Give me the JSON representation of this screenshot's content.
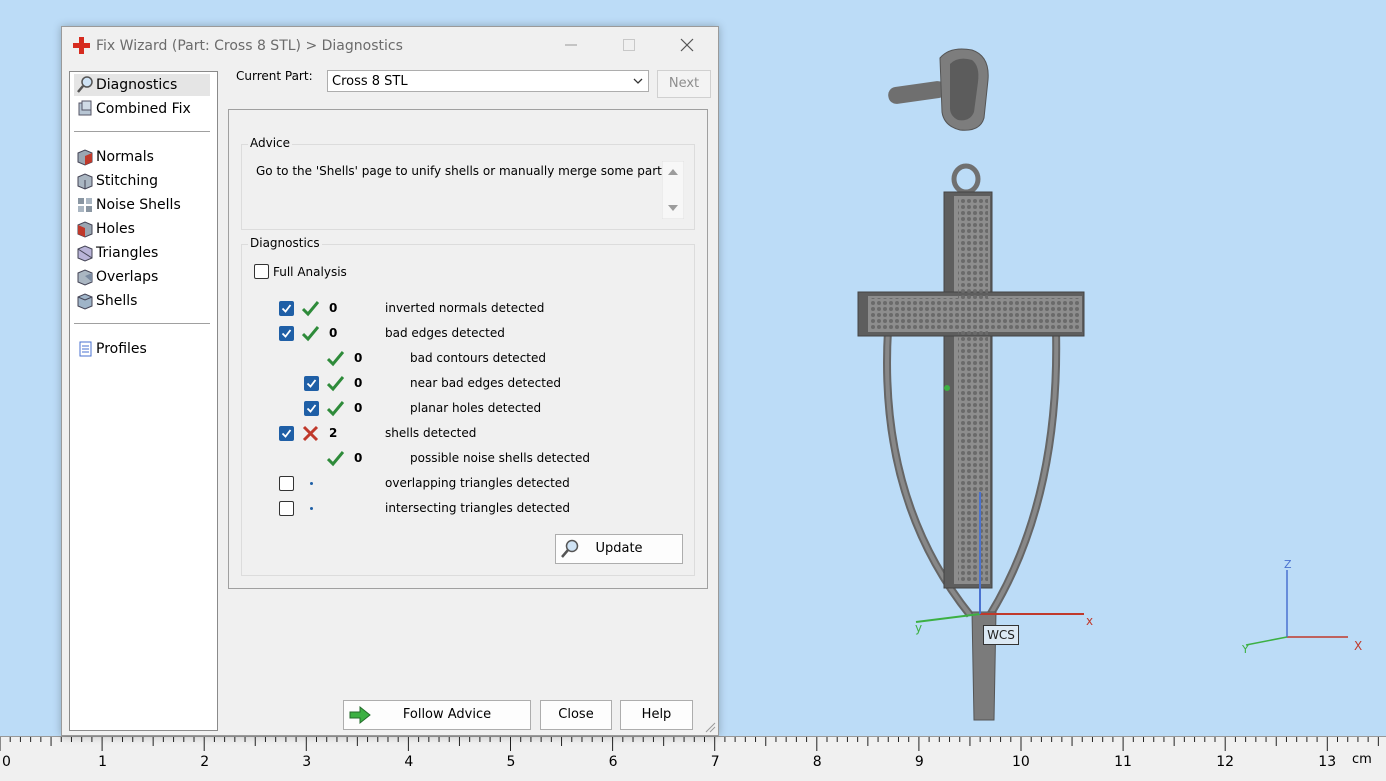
{
  "window": {
    "title": "Fix Wizard (Part: Cross 8 STL) > Diagnostics"
  },
  "nav": {
    "items": [
      {
        "label": "Diagnostics",
        "icon": "magnifier-icon"
      },
      {
        "label": "Combined Fix",
        "icon": "combined-fix-icon"
      },
      {
        "label": "Normals",
        "icon": "normals-cube-icon"
      },
      {
        "label": "Stitching",
        "icon": "stitching-cube-icon"
      },
      {
        "label": "Noise Shells",
        "icon": "noise-shells-cube-icon"
      },
      {
        "label": "Holes",
        "icon": "holes-cube-icon"
      },
      {
        "label": "Triangles",
        "icon": "triangles-cube-icon"
      },
      {
        "label": "Overlaps",
        "icon": "overlaps-cube-icon"
      },
      {
        "label": "Shells",
        "icon": "shells-cube-icon"
      },
      {
        "label": "Profiles",
        "icon": "document-icon"
      }
    ],
    "selected": "Diagnostics"
  },
  "part": {
    "label": "Current Part:",
    "value": "Cross 8 STL",
    "next_label": "Next"
  },
  "advice": {
    "title": "Advice",
    "text": "Go to the 'Shells' page to unify shells or manually merge some parts."
  },
  "diagnostics": {
    "title": "Diagnostics",
    "full_analysis_label": "Full Analysis",
    "full_analysis_checked": false,
    "rows": [
      {
        "checked": true,
        "status": "ok",
        "count": "0",
        "label": "inverted normals detected",
        "indent": 0
      },
      {
        "checked": true,
        "status": "ok",
        "count": "0",
        "label": "bad edges detected",
        "indent": 0
      },
      {
        "checked": null,
        "status": "ok",
        "count": "0",
        "label": "bad contours detected",
        "indent": 1
      },
      {
        "checked": true,
        "status": "ok",
        "count": "0",
        "label": "near bad edges detected",
        "indent": 1
      },
      {
        "checked": true,
        "status": "ok",
        "count": "0",
        "label": "planar holes detected",
        "indent": 1
      },
      {
        "checked": true,
        "status": "error",
        "count": "2",
        "label": "shells detected",
        "indent": 0
      },
      {
        "checked": null,
        "status": "ok",
        "count": "0",
        "label": "possible noise shells detected",
        "indent": 1
      },
      {
        "checked": false,
        "status": "none",
        "count": "",
        "label": "overlapping triangles detected",
        "indent": 0
      },
      {
        "checked": false,
        "status": "none",
        "count": "",
        "label": "intersecting triangles detected",
        "indent": 0
      }
    ],
    "update_label": "Update"
  },
  "footer": {
    "follow_advice_label": "Follow Advice",
    "close_label": "Close",
    "help_label": "Help"
  },
  "viewport": {
    "wcs_label": "WCS",
    "axis_x": "x",
    "axis_y": "y",
    "mini_z": "Z",
    "mini_y": "Y",
    "mini_x": "X"
  },
  "ruler": {
    "numbers": [
      "0",
      "1",
      "2",
      "3",
      "4",
      "5",
      "6",
      "7",
      "8",
      "9",
      "10",
      "11",
      "12",
      "13"
    ],
    "unit": "cm"
  },
  "colors": {
    "accent": "#1f5fa6",
    "ok_green": "#2e8b3a",
    "error_red": "#c0392b",
    "viewport_bg": "#bcdcf7"
  }
}
